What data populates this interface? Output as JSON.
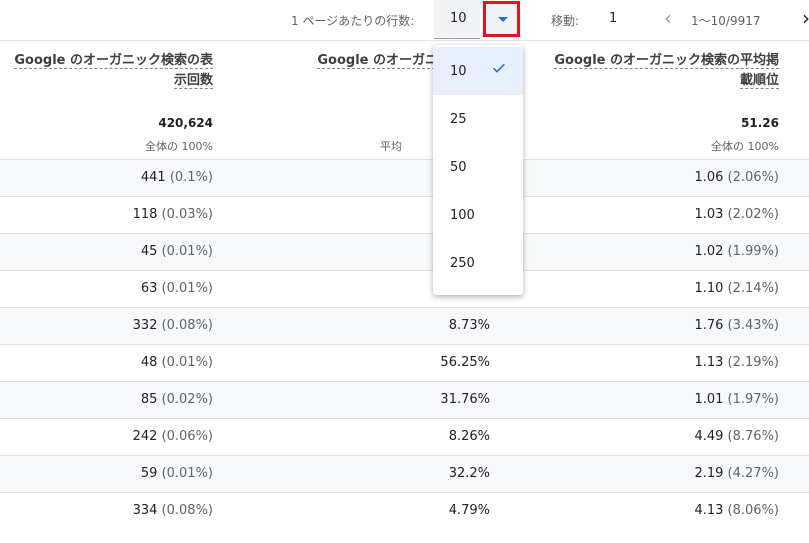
{
  "pager": {
    "rows_label": "1 ページあたりの行数:",
    "rows_value": "10",
    "goto_label": "移動:",
    "goto_value": "1",
    "range": "1〜10/9917"
  },
  "columns": [
    {
      "title": "Google のオーガニック検索の表示回数",
      "total": "420,624",
      "total_pct": "全体の 100%"
    },
    {
      "title": "Google のオーガニック検索",
      "total": "",
      "total_pct": "平均"
    },
    {
      "title": "Google のオーガニック検索の平均掲載順位",
      "total": "51.26",
      "total_pct": "全体の 100%"
    }
  ],
  "rows": [
    {
      "c1": "441",
      "c1s": "(0.1%)",
      "c2": "",
      "c3": "1.06",
      "c3s": "(2.06%)"
    },
    {
      "c1": "118",
      "c1s": "(0.03%)",
      "c2": "",
      "c3": "1.03",
      "c3s": "(2.02%)"
    },
    {
      "c1": "45",
      "c1s": "(0.01%)",
      "c2": "",
      "c3": "1.02",
      "c3s": "(1.99%)"
    },
    {
      "c1": "63",
      "c1s": "(0.01%)",
      "c2": "",
      "c3": "1.10",
      "c3s": "(2.14%)"
    },
    {
      "c1": "332",
      "c1s": "(0.08%)",
      "c2": "8.73%",
      "c3": "1.76",
      "c3s": "(3.43%)"
    },
    {
      "c1": "48",
      "c1s": "(0.01%)",
      "c2": "56.25%",
      "c3": "1.13",
      "c3s": "(2.19%)"
    },
    {
      "c1": "85",
      "c1s": "(0.02%)",
      "c2": "31.76%",
      "c3": "1.01",
      "c3s": "(1.97%)"
    },
    {
      "c1": "242",
      "c1s": "(0.06%)",
      "c2": "8.26%",
      "c3": "4.49",
      "c3s": "(8.76%)"
    },
    {
      "c1": "59",
      "c1s": "(0.01%)",
      "c2": "32.2%",
      "c3": "2.19",
      "c3s": "(4.27%)"
    },
    {
      "c1": "334",
      "c1s": "(0.08%)",
      "c2": "4.79%",
      "c3": "4.13",
      "c3s": "(8.06%)"
    }
  ],
  "dropdown": {
    "options": [
      "10",
      "25",
      "50",
      "100",
      "250"
    ],
    "selected": "10"
  },
  "colors": {
    "accent": "#1a73e8",
    "highlight_border": "#e0141e"
  }
}
